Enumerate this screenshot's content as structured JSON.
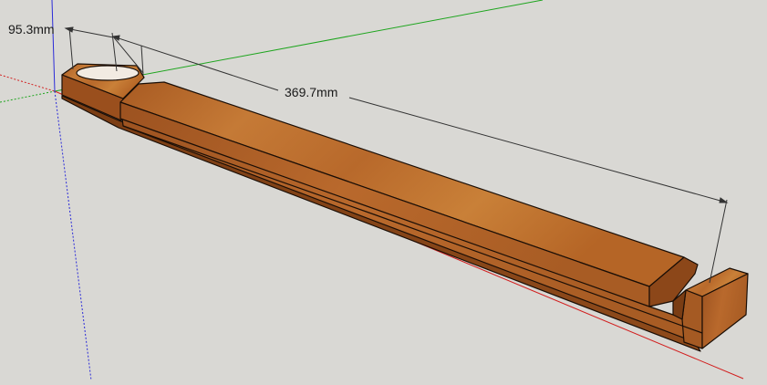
{
  "model": {
    "name": "wooden-rail",
    "material_color": "#b86a2c"
  },
  "dimensions": [
    {
      "label": "95.3mm"
    },
    {
      "label": "369.7mm"
    }
  ],
  "axes": {
    "red_axis_color": "#d21e1e",
    "green_axis_color": "#1ea51e",
    "blue_axis_color": "#2a2ad8"
  }
}
